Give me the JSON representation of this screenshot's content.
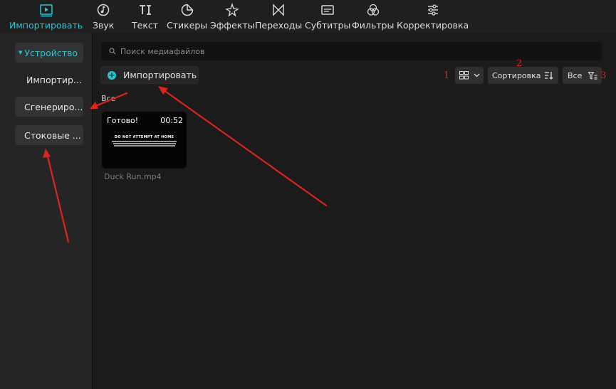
{
  "toolbar": {
    "tabs": [
      {
        "label": "Импортировать",
        "icon": "media-play-icon",
        "active": true
      },
      {
        "label": "Звук",
        "icon": "music-note-icon",
        "active": false
      },
      {
        "label": "Текст",
        "icon": "text-ti-icon",
        "active": false
      },
      {
        "label": "Стикеры",
        "icon": "sticker-icon",
        "active": false
      },
      {
        "label": "Эффекты",
        "icon": "sparkle-icon",
        "active": false
      },
      {
        "label": "Переходы",
        "icon": "bowtie-transition-icon",
        "active": false
      },
      {
        "label": "Субтитры",
        "icon": "caption-box-icon",
        "active": false
      },
      {
        "label": "Фильтры",
        "icon": "filter-circles-icon",
        "active": false
      },
      {
        "label": "Корректировка",
        "icon": "sliders-icon",
        "active": false
      }
    ],
    "accent_color": "#22c8d4"
  },
  "sidebar": {
    "device_label": "Устройство",
    "import_label": "Импортир...",
    "generated_label": "Сгенериро...",
    "stock_label": "Стоковые ..."
  },
  "main": {
    "search_placeholder": "Поиск медиафайлов",
    "import_button": "Импортировать",
    "sort_label": "Сортировка",
    "filter_label": "Все",
    "group_label": "Все",
    "media": [
      {
        "status": "Готово!",
        "duration": "00:52",
        "thumb_title": "DO NOT ATTEMPT AT HOME",
        "filename": "Duck Run.mp4"
      }
    ]
  },
  "annotations": {
    "marks": [
      "1",
      "2",
      "3"
    ],
    "color": "#e0231c"
  }
}
